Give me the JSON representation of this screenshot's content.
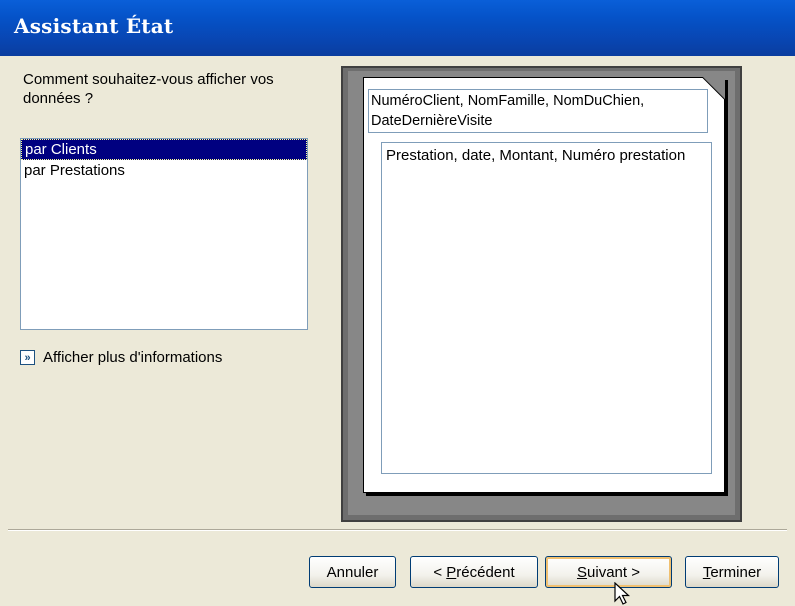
{
  "window": {
    "title": "Assistant État"
  },
  "prompt": {
    "text": "Comment souhaitez-vous afficher vos données ?"
  },
  "view_list": {
    "items": [
      {
        "label": "par Clients",
        "selected": true
      },
      {
        "label": "par Prestations",
        "selected": false
      }
    ]
  },
  "more_info": {
    "label": "Afficher plus d'informations",
    "icon": "double-chevron-right-icon"
  },
  "preview": {
    "group_fields": "NuméroClient, NomFamille, NomDuChien, DateDernièreVisite",
    "detail_fields": "Prestation, date, Montant, Numéro prestation"
  },
  "buttons": {
    "cancel": "Annuler",
    "previous_prefix": "< ",
    "previous_mnemonic": "P",
    "previous_rest": "récédent",
    "next_mnemonic": "S",
    "next_rest": "uivant >",
    "finish_mnemonic": "T",
    "finish_rest": "erminer"
  },
  "colors": {
    "titlebar": "#0553c9",
    "dialog_bg": "#ece9d8",
    "selection": "#000080"
  }
}
